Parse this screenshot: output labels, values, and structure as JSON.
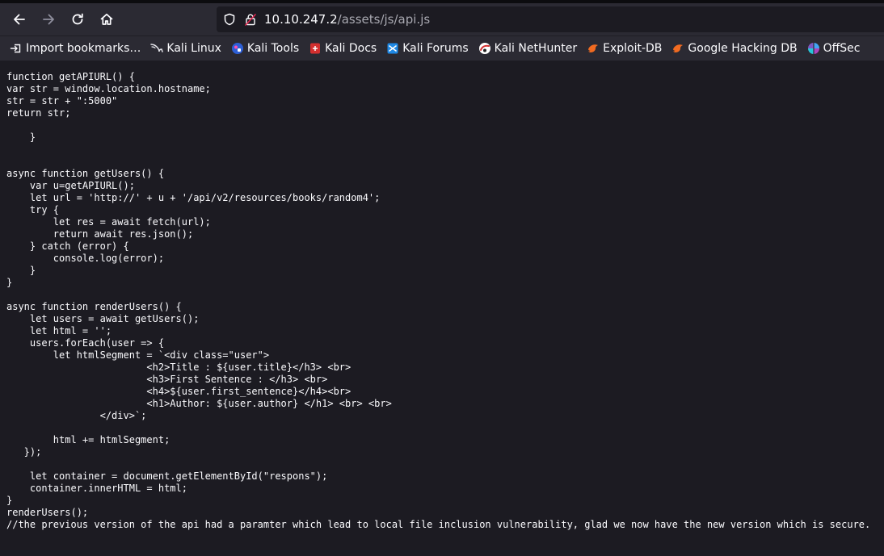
{
  "navigation": {
    "back_icon": "arrow-left-icon",
    "forward_icon": "arrow-right-icon",
    "reload_icon": "reload-icon",
    "home_icon": "home-icon"
  },
  "urlbar": {
    "host": "10.10.247.2",
    "path": "/assets/js/api.js"
  },
  "bookmarks": [
    {
      "label": "Import bookmarks…",
      "icon": "import-icon"
    },
    {
      "label": "Kali Linux",
      "icon": "kali-dragon-icon"
    },
    {
      "label": "Kali Tools",
      "icon": "kali-tools-icon"
    },
    {
      "label": "Kali Docs",
      "icon": "kali-docs-icon"
    },
    {
      "label": "Kali Forums",
      "icon": "kali-forums-icon"
    },
    {
      "label": "Kali NetHunter",
      "icon": "nethunter-icon"
    },
    {
      "label": "Exploit-DB",
      "icon": "exploit-db-icon"
    },
    {
      "label": "Google Hacking DB",
      "icon": "ghdb-icon"
    },
    {
      "label": "OffSec",
      "icon": "offsec-icon"
    }
  ],
  "source": {
    "text": "function getAPIURL() {\nvar str = window.location.hostname;\nstr = str + \":5000\"\nreturn str;\n\n    }\n\n\nasync function getUsers() {\n    var u=getAPIURL();\n    let url = 'http://' + u + '/api/v2/resources/books/random4';\n    try {\n        let res = await fetch(url);\n        return await res.json();\n    } catch (error) {\n        console.log(error);\n    }\n}\n\nasync function renderUsers() {\n    let users = await getUsers();\n    let html = '';\n    users.forEach(user => {\n        let htmlSegment = `<div class=\"user\">\n                        <h2>Title : ${user.title}</h3> <br>\n                        <h3>First Sentence : </h3> <br>\n                        <h4>${user.first_sentence}</h4><br>\n                        <h1>Author: ${user.author} </h1> <br> <br>\n                </div>`;\n\n        html += htmlSegment;\n   });\n\n    let container = document.getElementById(\"respons\");\n    container.innerHTML = html;\n}\nrenderUsers();\n//the previous version of the api had a paramter which lead to local file inclusion vulnerability, glad we now have the new version which is secure."
  }
}
